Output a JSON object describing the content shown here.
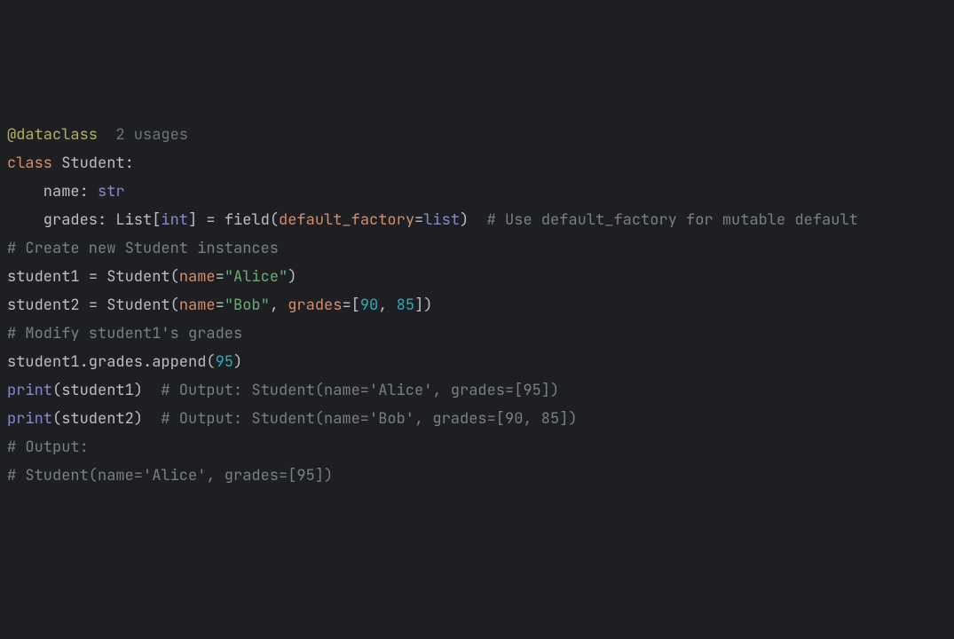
{
  "code": {
    "blank1": "",
    "l1": {
      "decorator": "@dataclass",
      "spacing": "  ",
      "hint": "2 usages"
    },
    "l2": {
      "kw": "class",
      "rest": " Student:"
    },
    "l3": {
      "indent": "    name: ",
      "type": "str"
    },
    "l4": {
      "indent": "    grades: List[",
      "type": "int",
      "after_type": "] = field(",
      "param": "default_factory",
      "eq": "=",
      "builtin": "list",
      "close": ")  ",
      "comment": "# Use default_factory for mutable default"
    },
    "blank2": "",
    "blank3": "",
    "l5": {
      "comment": "# Create new Student instances"
    },
    "l6": {
      "pre": "student1 = Student(",
      "param": "name",
      "eq": "=",
      "str": "\"Alice\"",
      "close": ")"
    },
    "l7": {
      "pre": "student2 = Student(",
      "param1": "name",
      "eq1": "=",
      "str": "\"Bob\"",
      "comma": ", ",
      "param2": "grades",
      "eq2": "=[",
      "num1": "90",
      "sep": ", ",
      "num2": "85",
      "close": "])"
    },
    "blank4": "",
    "l8": {
      "comment": "# Modify student1's grades"
    },
    "l9": {
      "pre": "student1.grades.append(",
      "num": "95",
      "close": ")"
    },
    "blank5": "",
    "l10": {
      "func": "print",
      "args": "(student1)  ",
      "comment": "# Output: Student(name='Alice', grades=[95])"
    },
    "l11": {
      "func": "print",
      "args": "(student2)  ",
      "comment": "# Output: Student(name='Bob', grades=[90, 85])"
    },
    "blank6": "",
    "blank7": "",
    "l12": {
      "comment": "# Output:"
    },
    "l13": {
      "comment": "# Student(name='Alice', grades=[95])"
    }
  }
}
